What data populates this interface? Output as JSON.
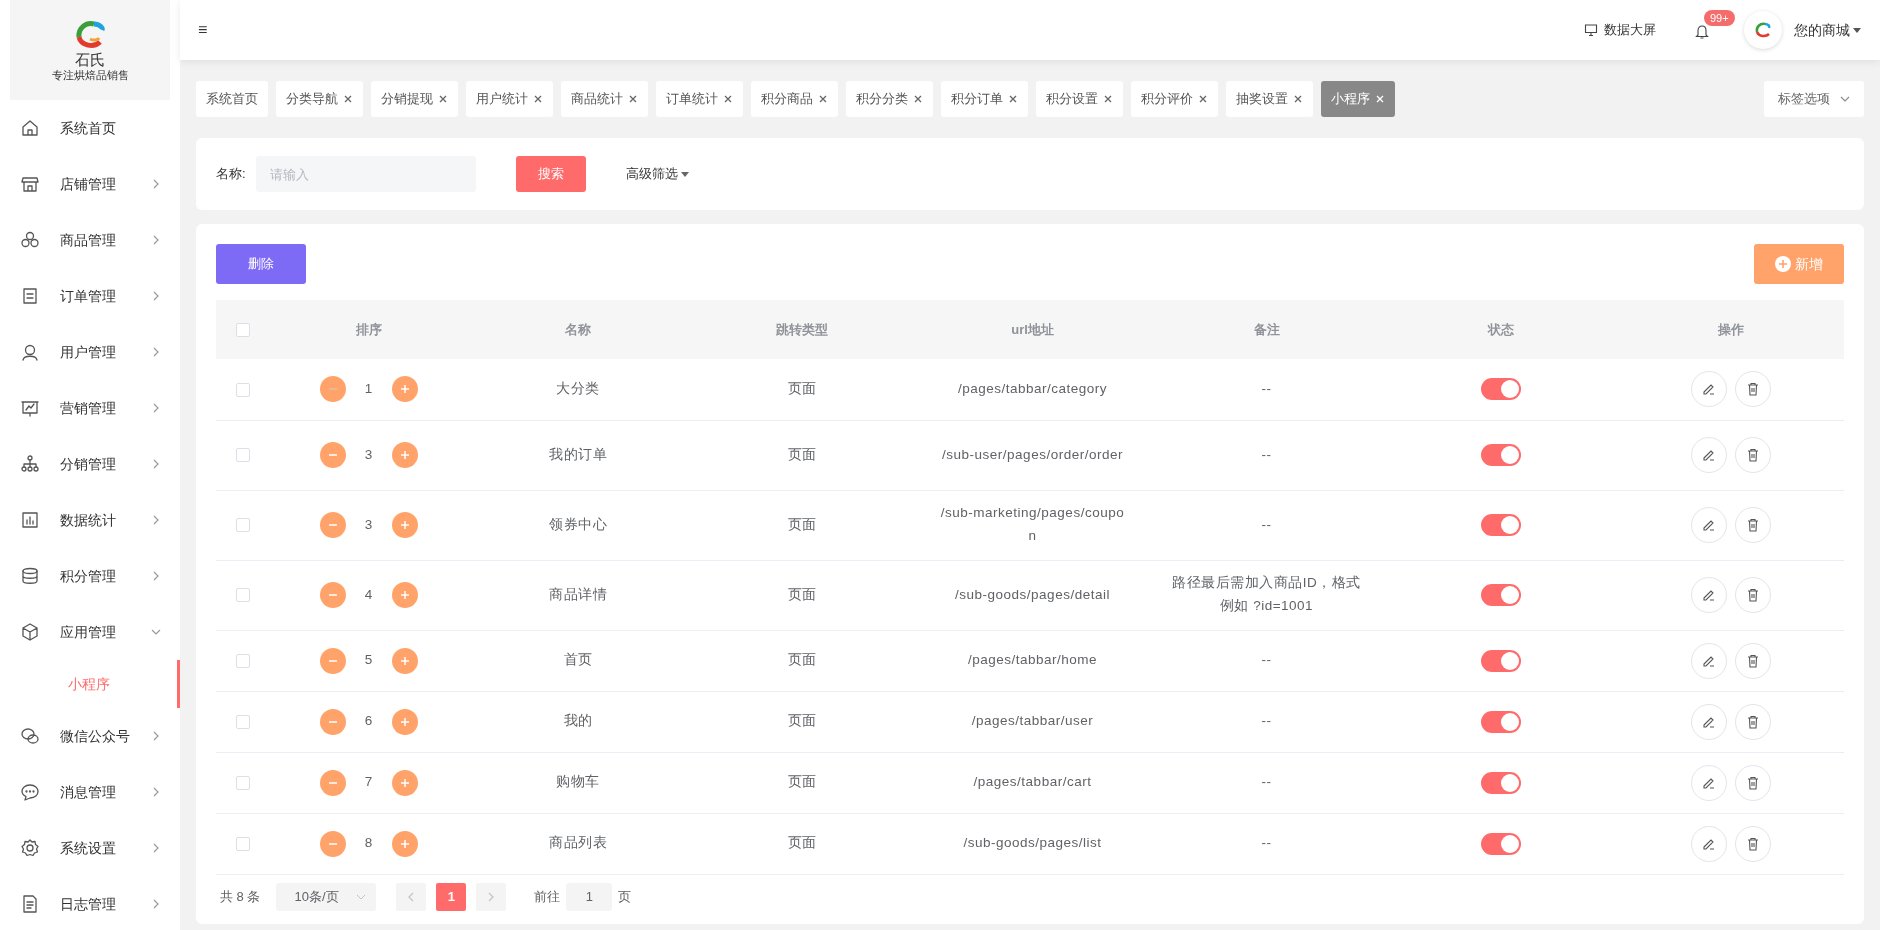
{
  "logo": {
    "name": "石氏",
    "tagline": "专注烘焙品销售"
  },
  "sidebar": {
    "items": [
      {
        "label": "系统首页",
        "has_children": false
      },
      {
        "label": "店铺管理",
        "has_children": true,
        "expanded": false
      },
      {
        "label": "商品管理",
        "has_children": true,
        "expanded": false
      },
      {
        "label": "订单管理",
        "has_children": true,
        "expanded": false
      },
      {
        "label": "用户管理",
        "has_children": true,
        "expanded": false
      },
      {
        "label": "营销管理",
        "has_children": true,
        "expanded": false
      },
      {
        "label": "分销管理",
        "has_children": true,
        "expanded": false
      },
      {
        "label": "数据统计",
        "has_children": true,
        "expanded": false
      },
      {
        "label": "积分管理",
        "has_children": true,
        "expanded": false
      },
      {
        "label": "应用管理",
        "has_children": true,
        "expanded": true,
        "children": [
          {
            "label": "小程序",
            "selected": true
          }
        ]
      },
      {
        "label": "微信公众号",
        "has_children": true,
        "expanded": false
      },
      {
        "label": "消息管理",
        "has_children": true,
        "expanded": false
      },
      {
        "label": "系统设置",
        "has_children": true,
        "expanded": false
      },
      {
        "label": "日志管理",
        "has_children": true,
        "expanded": false
      }
    ]
  },
  "header": {
    "menu_toggle": "≡",
    "screen_link": "数据大屏",
    "notification_badge": "99+",
    "user_name": "您的商城"
  },
  "tabs": [
    {
      "label": "系统首页",
      "closable": false,
      "selected": false
    },
    {
      "label": "分类导航",
      "closable": true,
      "selected": false
    },
    {
      "label": "分销提现",
      "closable": true,
      "selected": false
    },
    {
      "label": "用户统计",
      "closable": true,
      "selected": false
    },
    {
      "label": "商品统计",
      "closable": true,
      "selected": false
    },
    {
      "label": "订单统计",
      "closable": true,
      "selected": false
    },
    {
      "label": "积分商品",
      "closable": true,
      "selected": false
    },
    {
      "label": "积分分类",
      "closable": true,
      "selected": false
    },
    {
      "label": "积分订单",
      "closable": true,
      "selected": false
    },
    {
      "label": "积分设置",
      "closable": true,
      "selected": false
    },
    {
      "label": "积分评价",
      "closable": true,
      "selected": false
    },
    {
      "label": "抽奖设置",
      "closable": true,
      "selected": false
    },
    {
      "label": "小程序",
      "closable": true,
      "selected": true
    }
  ],
  "tab_options": "标签选项",
  "filter": {
    "label": "名称:",
    "placeholder": "请输入",
    "search_button": "搜索",
    "advanced": "高级筛选"
  },
  "toolbar": {
    "delete_button": "删除",
    "add_button": "新增"
  },
  "table": {
    "columns": [
      "排序",
      "名称",
      "跳转类型",
      "url地址",
      "备注",
      "状态",
      "操作"
    ],
    "header_checked": false,
    "rows": [
      {
        "checked": false,
        "sort": "1",
        "can_decrease": false,
        "name": "大分类",
        "type": "页面",
        "url": "/pages/tabbar/category",
        "note": "--",
        "on": true
      },
      {
        "checked": false,
        "sort": "3",
        "can_decrease": true,
        "name": "我的订单",
        "type": "页面",
        "url": "/sub-user/pages/order/order",
        "note": "--",
        "on": true
      },
      {
        "checked": false,
        "sort": "3",
        "can_decrease": true,
        "name": "领券中心",
        "type": "页面",
        "url": "/sub-marketing/pages/coupon",
        "note": "--",
        "on": true
      },
      {
        "checked": false,
        "sort": "4",
        "can_decrease": true,
        "name": "商品详情",
        "type": "页面",
        "url": "/sub-goods/pages/detail",
        "note": "路径最后需加入商品ID，格式例如 ?id=1001",
        "on": true
      },
      {
        "checked": false,
        "sort": "5",
        "can_decrease": true,
        "name": "首页",
        "type": "页面",
        "url": "/pages/tabbar/home",
        "note": "--",
        "on": true
      },
      {
        "checked": false,
        "sort": "6",
        "can_decrease": true,
        "name": "我的",
        "type": "页面",
        "url": "/pages/tabbar/user",
        "note": "--",
        "on": true
      },
      {
        "checked": false,
        "sort": "7",
        "can_decrease": true,
        "name": "购物车",
        "type": "页面",
        "url": "/pages/tabbar/cart",
        "note": "--",
        "on": true
      },
      {
        "checked": false,
        "sort": "8",
        "can_decrease": true,
        "name": "商品列表",
        "type": "页面",
        "url": "/sub-goods/pages/list",
        "note": "--",
        "on": true
      }
    ]
  },
  "pagination": {
    "total": "共 8 条",
    "page_size": "10条/页",
    "pages": [
      {
        "label": "1",
        "selected": true
      }
    ],
    "goto_label": "前往",
    "goto_value": "1",
    "goto_suffix": "页"
  }
}
